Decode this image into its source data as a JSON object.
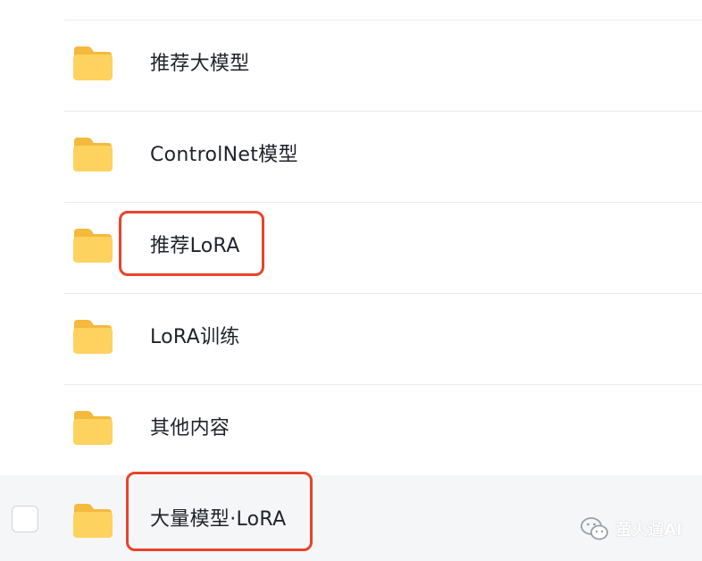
{
  "folders": [
    {
      "name": "推荐大模型"
    },
    {
      "name": "ControlNet模型"
    },
    {
      "name": "推荐LoRA"
    },
    {
      "name": "LoRA训练"
    },
    {
      "name": "其他内容"
    },
    {
      "name": "大量模型·LoRA"
    }
  ],
  "watermark": {
    "text": "萤火遛AI",
    "icon": "wechat-icon"
  },
  "colors": {
    "folder": "#fdd25e",
    "highlight": "#e8432c",
    "hover_row": "#f5f6f8",
    "divider": "#e9ebee"
  },
  "icons": {
    "folder": "folder-icon",
    "checkbox": "checkbox-icon"
  }
}
